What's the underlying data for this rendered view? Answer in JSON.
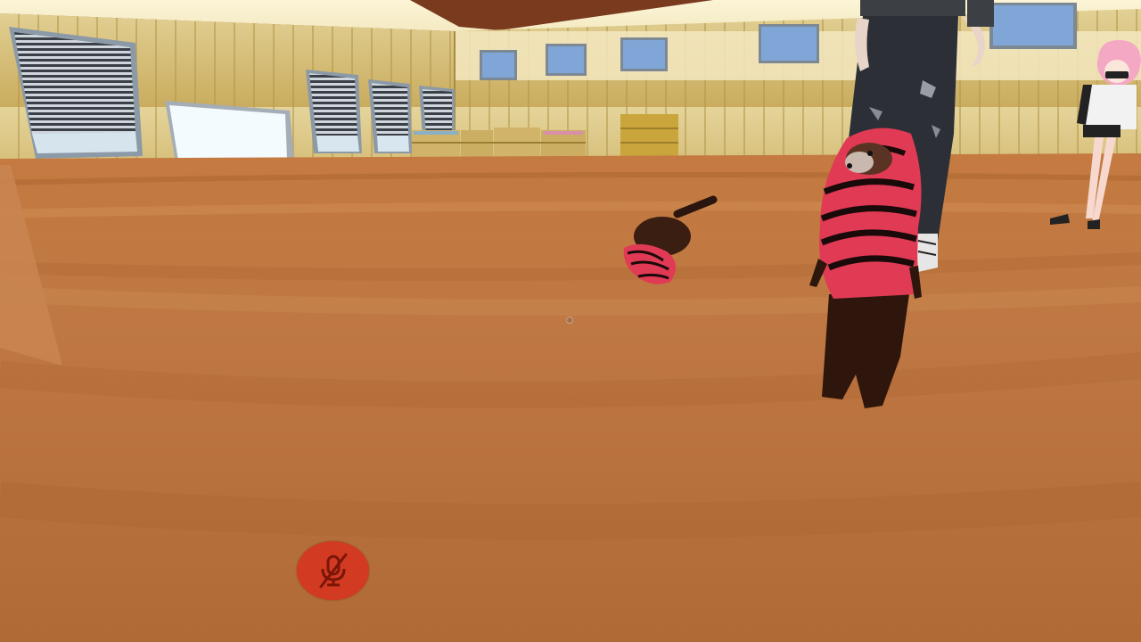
{
  "hud": {
    "mic_button": {
      "state": "muted",
      "icon": "microphone-muted-icon",
      "color": "#d23a22"
    },
    "crosshair": {
      "icon": "crosshair-dot"
    }
  },
  "scene": {
    "type": "3D virtual world room",
    "elements": [
      "wooden-floor",
      "wall-windows",
      "wooden-shelves",
      "ferret-avatar-standing",
      "ferret-avatar-small",
      "player-avatar-legs",
      "anime-avatar"
    ]
  },
  "colors": {
    "floor": "#b87040",
    "wall": "#d8bf78",
    "hoodie": "#e03a55",
    "mic_muted": "#d23a22"
  }
}
